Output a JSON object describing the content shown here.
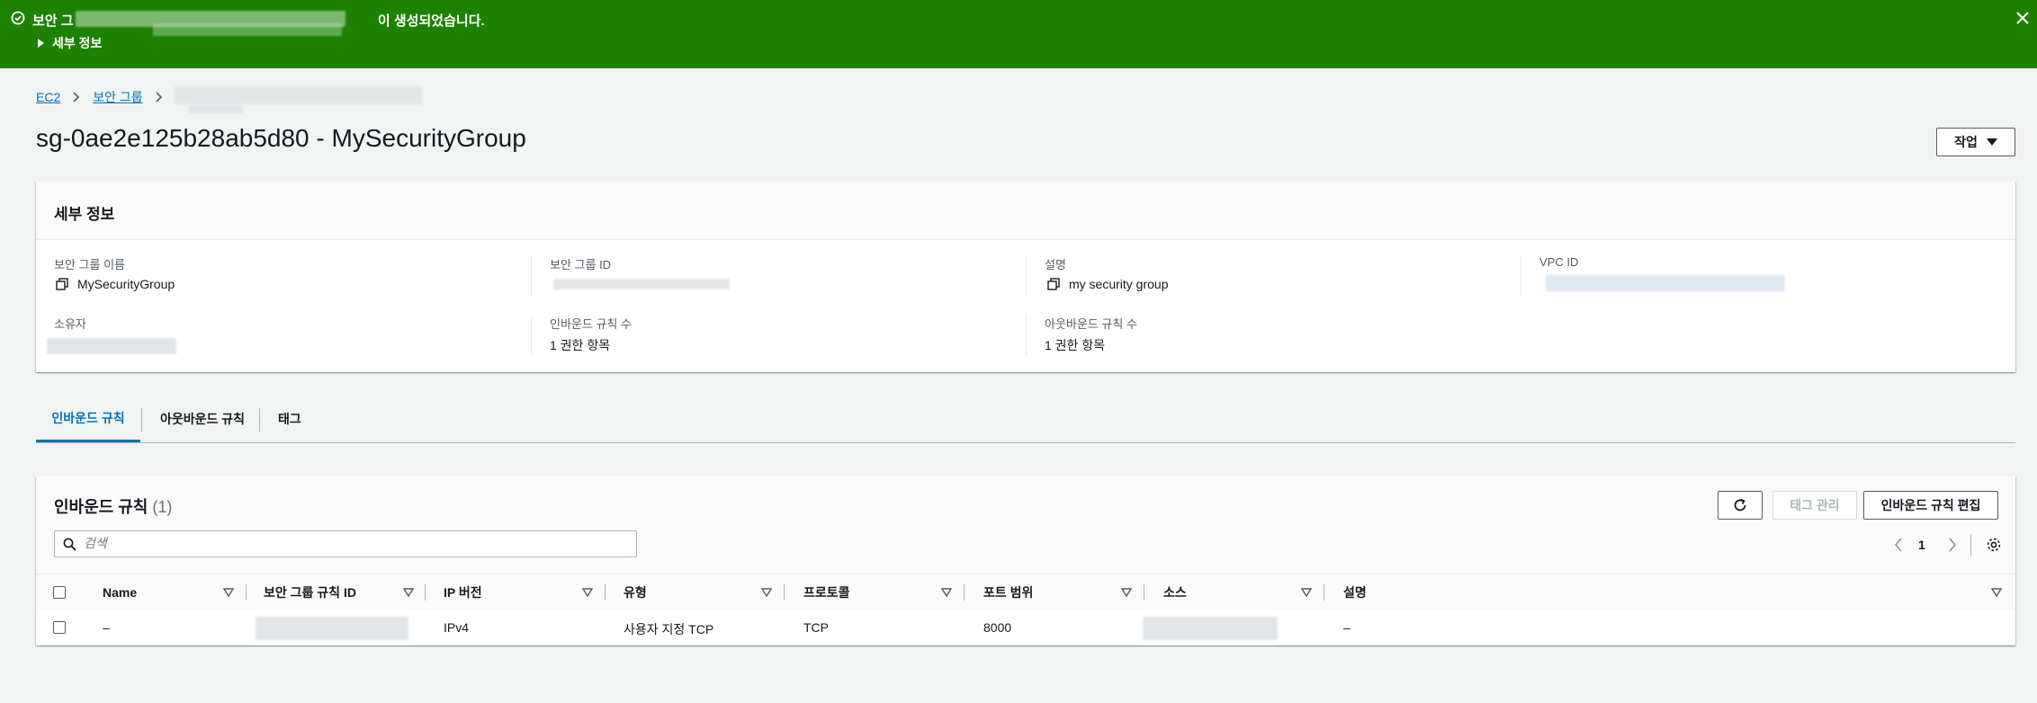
{
  "flash": {
    "message_start": "보안 그",
    "message_end": "이 생성되었습니다.",
    "details_label": "세부 정보"
  },
  "breadcrumb": {
    "ec2": "EC2",
    "security_groups": "보안 그룹"
  },
  "page_title": "sg-0ae2e125b28ab5d80 - MySecurityGroup",
  "actions_label": "작업",
  "details": {
    "header": "세부 정보",
    "sg_name_label": "보안 그룹 이름",
    "sg_name_value": "MySecurityGroup",
    "sg_id_label": "보안 그룹 ID",
    "description_label": "설명",
    "description_value": "my security group",
    "vpc_id_label": "VPC ID",
    "owner_label": "소유자",
    "inbound_count_label": "인바운드 규칙 수",
    "inbound_count_value": "1 권한 항목",
    "outbound_count_label": "아웃바운드 규칙 수",
    "outbound_count_value": "1 권한 항목"
  },
  "tabs": [
    {
      "label": "인바운드 규칙"
    },
    {
      "label": "아웃바운드 규칙"
    },
    {
      "label": "태그"
    }
  ],
  "rules": {
    "title": "인바운드 규칙",
    "count": "(1)",
    "manage_tags_label": "태그 관리",
    "edit_label": "인바운드 규칙 편집",
    "search_placeholder": "검색",
    "page_number": "1",
    "columns": [
      "Name",
      "보안 그룹 규칙 ID",
      "IP 버전",
      "유형",
      "프로토콜",
      "포트 범위",
      "소스",
      "설명"
    ],
    "rows": [
      {
        "name": "–",
        "ip_version": "IPv4",
        "type": "사용자 지정 TCP",
        "protocol": "TCP",
        "port_range": "8000",
        "description": "–"
      }
    ]
  },
  "colors": {
    "flash_bg": "#1d8102",
    "link": "#0073bb",
    "background": "#f2f3f3"
  }
}
